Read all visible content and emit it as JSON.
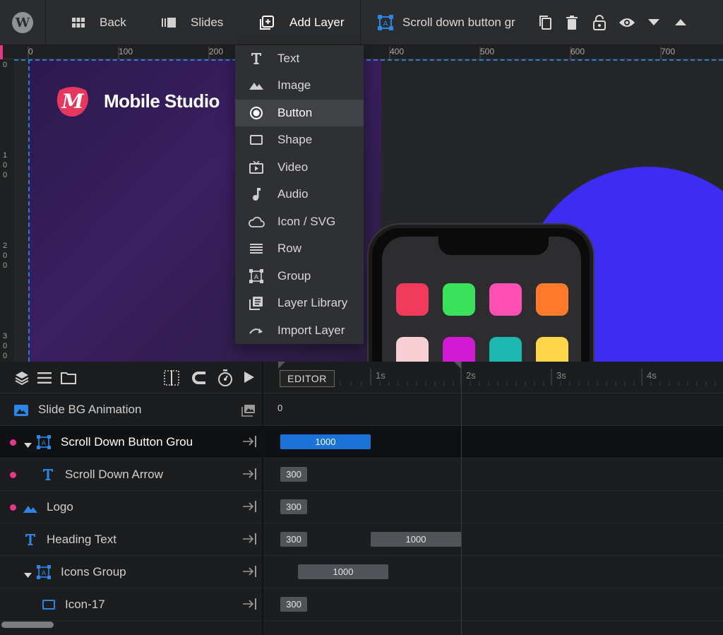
{
  "toolbar": {
    "back_label": "Back",
    "slides_label": "Slides",
    "add_layer_label": "Add Layer",
    "selected_layer_label": "Scroll down button gr"
  },
  "ruler": {
    "top_labels": [
      "0",
      "100",
      "200",
      "400",
      "500",
      "600",
      "700"
    ],
    "left_labels": [
      [
        "0"
      ],
      [
        "1",
        "0",
        "0"
      ],
      [
        "2",
        "0",
        "0"
      ],
      [
        "3",
        "0",
        "0"
      ]
    ]
  },
  "canvas": {
    "logo_text": "Mobile Studio",
    "logo_mark": "M",
    "app_colors": [
      "#f23a5a",
      "#39e25a",
      "#ff4fb3",
      "#ff7a2a",
      "#f7cfd3",
      "#d31ad3",
      "#1fb8b1",
      "#ffd54a"
    ],
    "circle_color": "#3d2cf2"
  },
  "add_layer_menu": {
    "items": [
      {
        "label": "Text",
        "icon": "text-icon"
      },
      {
        "label": "Image",
        "icon": "image-icon"
      },
      {
        "label": "Button",
        "icon": "button-icon",
        "active": true
      },
      {
        "label": "Shape",
        "icon": "shape-icon"
      },
      {
        "label": "Video",
        "icon": "video-icon"
      },
      {
        "label": "Audio",
        "icon": "audio-icon"
      },
      {
        "label": "Icon / SVG",
        "icon": "cloud-icon"
      },
      {
        "label": "Row",
        "icon": "row-icon"
      },
      {
        "label": "Group",
        "icon": "group-icon"
      },
      {
        "label": "Layer Library",
        "icon": "library-icon"
      },
      {
        "label": "Import Layer",
        "icon": "import-icon"
      }
    ]
  },
  "timeline": {
    "editor_label": "EDITOR",
    "seconds": [
      "1s",
      "2s",
      "3s",
      "4s"
    ],
    "bg_start_label": "0"
  },
  "layers": [
    {
      "label": "Slide BG Animation",
      "icon": "image-icon"
    },
    {
      "label": "Scroll Down Button Grou",
      "icon": "group-icon",
      "selected": true,
      "dot": true,
      "expanded": true,
      "bars": [
        {
          "label": "1000",
          "blue": true
        }
      ]
    },
    {
      "label": "Scroll Down Arrow",
      "icon": "text-icon",
      "dot": true,
      "bars": [
        {
          "label": "300"
        }
      ]
    },
    {
      "label": "Logo",
      "icon": "image-icon",
      "dot": true,
      "bars": [
        {
          "label": "300"
        }
      ]
    },
    {
      "label": "Heading Text",
      "icon": "text-icon",
      "bars": [
        {
          "label": "300"
        },
        {
          "label": "1000"
        }
      ]
    },
    {
      "label": "Icons Group",
      "icon": "group-icon",
      "expanded": true,
      "bars": [
        {
          "label": "1000"
        }
      ]
    },
    {
      "label": "Icon-17",
      "icon": "shape-icon",
      "bars": [
        {
          "label": "300"
        }
      ]
    }
  ]
}
